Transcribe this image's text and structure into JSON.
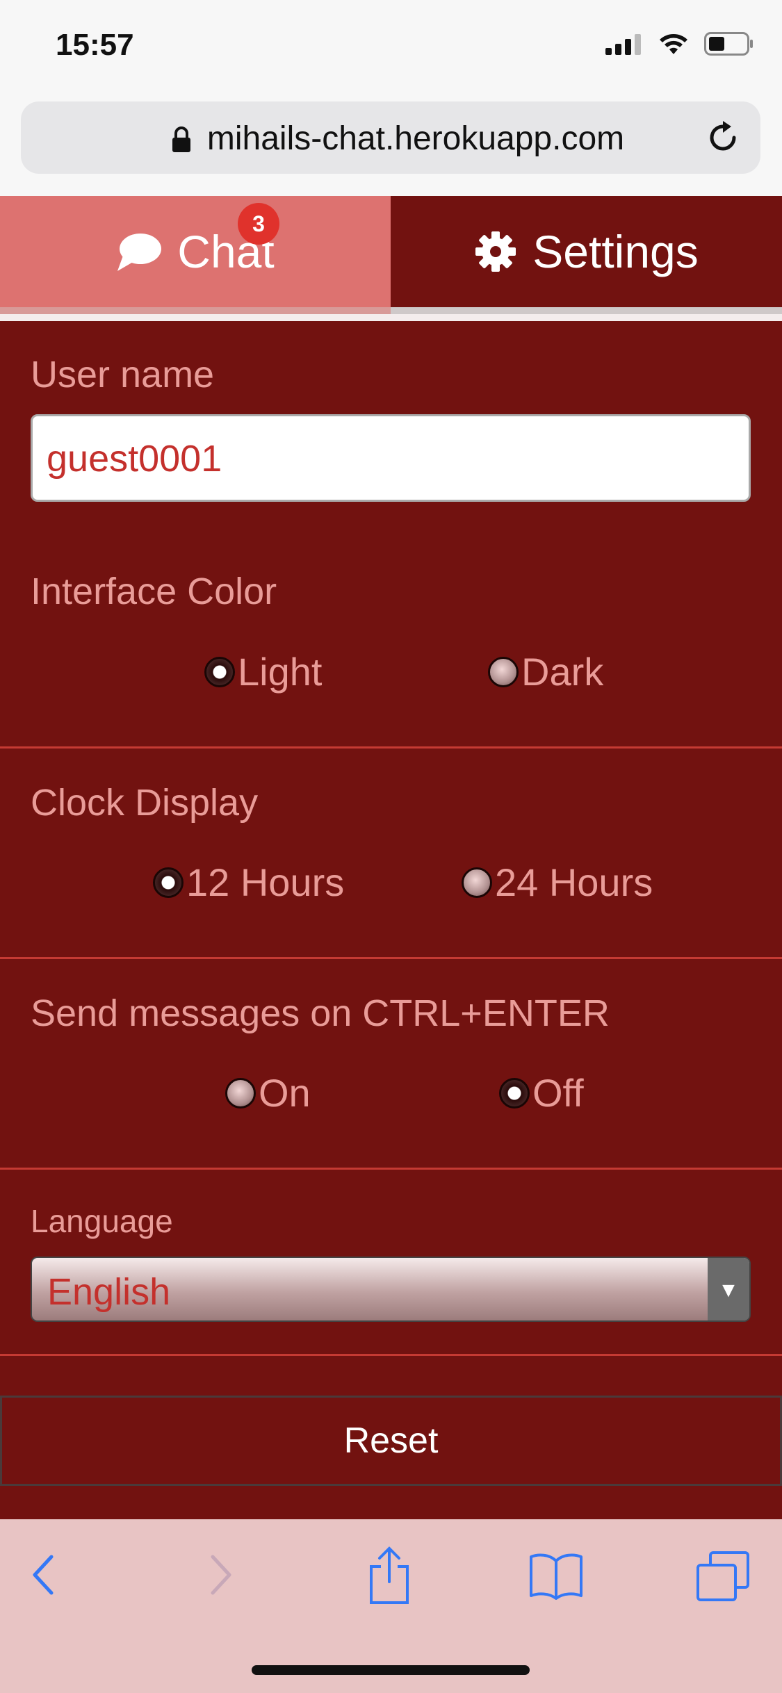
{
  "status_bar": {
    "time": "15:57"
  },
  "browser": {
    "url": "mihails-chat.herokuapp.com"
  },
  "tabs": [
    {
      "label": "Chat",
      "badge": "3",
      "active": false
    },
    {
      "label": "Settings",
      "active": true
    }
  ],
  "settings": {
    "username": {
      "label": "User name",
      "value": "guest0001"
    },
    "interface_color": {
      "label": "Interface Color",
      "options": [
        "Light",
        "Dark"
      ],
      "selected": "Light"
    },
    "clock_display": {
      "label": "Clock Display",
      "options": [
        "12 Hours",
        "24 Hours"
      ],
      "selected": "12 Hours"
    },
    "ctrl_enter": {
      "label": "Send messages on CTRL+ENTER",
      "options": [
        "On",
        "Off"
      ],
      "selected": "Off"
    },
    "language": {
      "label": "Language",
      "value": "English"
    },
    "reset_label": "Reset"
  },
  "colors": {
    "background": "#721210",
    "active_tab": "#dd7270",
    "label_text": "#e99c98",
    "input_text": "#c4302c",
    "separator": "#c53a33",
    "toolbar": "#e8c4c4",
    "toolbar_icon": "#3478f6"
  }
}
